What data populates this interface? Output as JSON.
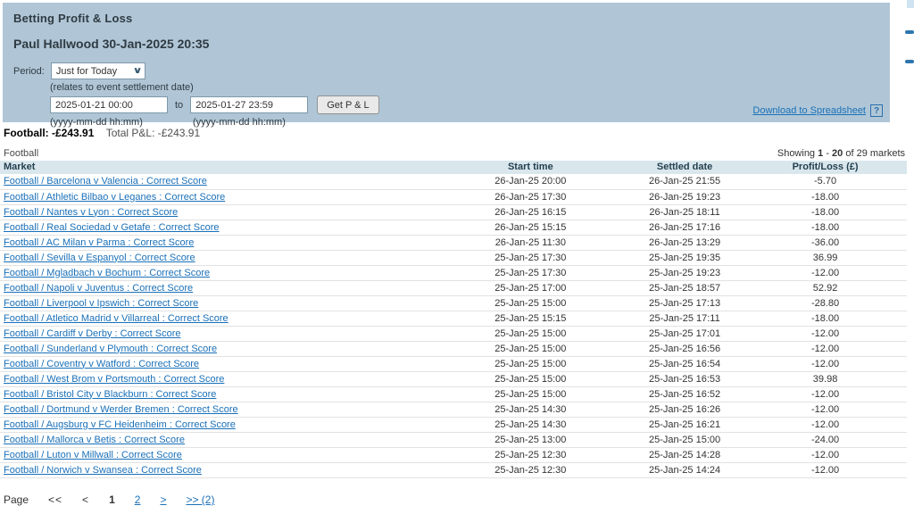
{
  "header": {
    "title": "Betting Profit & Loss",
    "subtitle": "Paul Hallwood 30-Jan-2025 20:35",
    "period_label": "Period:",
    "period_value": "Just for Today",
    "period_note": "(relates to event settlement date)",
    "date_from": "2025-01-21 00:00",
    "to_label": "to",
    "date_to": "2025-01-27 23:59",
    "get_pl_button": "Get P & L",
    "date_format_hint_from": "(yyyy-mm-dd hh:mm)",
    "date_format_hint_to": "(yyyy-mm-dd hh:mm)",
    "download_link": "Download to Spreadsheet",
    "help_icon": "?"
  },
  "summary": {
    "sport_label": "Football:",
    "sport_value": "-£243.91",
    "total_label": "Total P&L:",
    "total_value": "-£243.91"
  },
  "table": {
    "section_label": "Football",
    "showing_prefix": "Showing",
    "showing_from": "1",
    "showing_sep": "-",
    "showing_to": "20",
    "showing_suffix": "of 29 markets",
    "columns": [
      "Market",
      "Start time",
      "Settled date",
      "Profit/Loss (£)"
    ],
    "rows": [
      {
        "market": "Football / Barcelona v Valencia : Correct Score",
        "start": "26-Jan-25 20:00",
        "settled": "26-Jan-25 21:55",
        "pl": "-5.70"
      },
      {
        "market": "Football / Athletic Bilbao v Leganes : Correct Score",
        "start": "26-Jan-25 17:30",
        "settled": "26-Jan-25 19:23",
        "pl": "-18.00"
      },
      {
        "market": "Football / Nantes v Lyon : Correct Score",
        "start": "26-Jan-25 16:15",
        "settled": "26-Jan-25 18:11",
        "pl": "-18.00"
      },
      {
        "market": "Football / Real Sociedad v Getafe : Correct Score",
        "start": "26-Jan-25 15:15",
        "settled": "26-Jan-25 17:16",
        "pl": "-18.00"
      },
      {
        "market": "Football / AC Milan v Parma : Correct Score",
        "start": "26-Jan-25 11:30",
        "settled": "26-Jan-25 13:29",
        "pl": "-36.00"
      },
      {
        "market": "Football / Sevilla v Espanyol : Correct Score",
        "start": "25-Jan-25 17:30",
        "settled": "25-Jan-25 19:35",
        "pl": "36.99"
      },
      {
        "market": "Football / Mgladbach v Bochum : Correct Score",
        "start": "25-Jan-25 17:30",
        "settled": "25-Jan-25 19:23",
        "pl": "-12.00"
      },
      {
        "market": "Football / Napoli v Juventus : Correct Score",
        "start": "25-Jan-25 17:00",
        "settled": "25-Jan-25 18:57",
        "pl": "52.92"
      },
      {
        "market": "Football / Liverpool v Ipswich : Correct Score",
        "start": "25-Jan-25 15:00",
        "settled": "25-Jan-25 17:13",
        "pl": "-28.80"
      },
      {
        "market": "Football / Atletico Madrid v Villarreal : Correct Score",
        "start": "25-Jan-25 15:15",
        "settled": "25-Jan-25 17:11",
        "pl": "-18.00"
      },
      {
        "market": "Football / Cardiff v Derby : Correct Score",
        "start": "25-Jan-25 15:00",
        "settled": "25-Jan-25 17:01",
        "pl": "-12.00"
      },
      {
        "market": "Football / Sunderland v Plymouth : Correct Score",
        "start": "25-Jan-25 15:00",
        "settled": "25-Jan-25 16:56",
        "pl": "-12.00"
      },
      {
        "market": "Football / Coventry v Watford : Correct Score",
        "start": "25-Jan-25 15:00",
        "settled": "25-Jan-25 16:54",
        "pl": "-12.00"
      },
      {
        "market": "Football / West Brom v Portsmouth : Correct Score",
        "start": "25-Jan-25 15:00",
        "settled": "25-Jan-25 16:53",
        "pl": "39.98"
      },
      {
        "market": "Football / Bristol City v Blackburn : Correct Score",
        "start": "25-Jan-25 15:00",
        "settled": "25-Jan-25 16:52",
        "pl": "-12.00"
      },
      {
        "market": "Football / Dortmund v Werder Bremen : Correct Score",
        "start": "25-Jan-25 14:30",
        "settled": "25-Jan-25 16:26",
        "pl": "-12.00"
      },
      {
        "market": "Football / Augsburg v FC Heidenheim : Correct Score",
        "start": "25-Jan-25 14:30",
        "settled": "25-Jan-25 16:21",
        "pl": "-12.00"
      },
      {
        "market": "Football / Mallorca v Betis : Correct Score",
        "start": "25-Jan-25 13:00",
        "settled": "25-Jan-25 15:00",
        "pl": "-24.00"
      },
      {
        "market": "Football / Luton v Millwall : Correct Score",
        "start": "25-Jan-25 12:30",
        "settled": "25-Jan-25 14:28",
        "pl": "-12.00"
      },
      {
        "market": "Football / Norwich v Swansea : Correct Score",
        "start": "25-Jan-25 12:30",
        "settled": "25-Jan-25 14:24",
        "pl": "-12.00"
      }
    ]
  },
  "pagination": {
    "label": "Page",
    "first_symbol": "<<",
    "prev_symbol": "<",
    "current_page": "1",
    "page_2": "2",
    "next_symbol": ">",
    "last_symbol": ">> (2)"
  },
  "colors": {
    "panel_background": "#b0c6d6",
    "table_header_background": "#d9e7ed",
    "link_blue": "#1a70b8",
    "text_dark": "#333333",
    "row_divider": "#e2e2e2"
  }
}
